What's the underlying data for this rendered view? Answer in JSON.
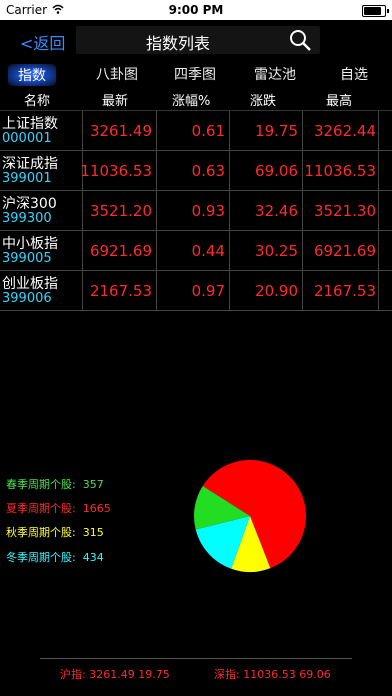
{
  "status": {
    "carrier": "Carrier",
    "time": "9:00 PM",
    "battery_level": 0.95
  },
  "nav": {
    "back_label": "<返回",
    "title": "指数列表"
  },
  "tabs": [
    "指数",
    "八卦图",
    "四季图",
    "雷达池",
    "自选"
  ],
  "columns": [
    "名称",
    "最新",
    "涨幅%",
    "涨跌",
    "最高"
  ],
  "rows": [
    {
      "name": "上证指数",
      "code": "000001",
      "latest": "3261.49",
      "pct": "0.61",
      "change": "19.75",
      "high": "3262.44"
    },
    {
      "name": "深证成指",
      "code": "399001",
      "latest": "11036.53",
      "pct": "0.63",
      "change": "69.06",
      "high": "11036.53"
    },
    {
      "name": "沪深300",
      "code": "399300",
      "latest": "3521.20",
      "pct": "0.93",
      "change": "32.46",
      "high": "3521.30"
    },
    {
      "name": "中小板指",
      "code": "399005",
      "latest": "6921.69",
      "pct": "0.44",
      "change": "30.25",
      "high": "6921.69"
    },
    {
      "name": "创业板指",
      "code": "399006",
      "latest": "2167.53",
      "pct": "0.97",
      "change": "20.90",
      "high": "2167.53"
    }
  ],
  "seasons": {
    "spring": {
      "label": "春季周期个股:",
      "count": "357"
    },
    "summer": {
      "label": "夏季周期个股:",
      "count": "1665"
    },
    "autumn": {
      "label": "秋季周期个股:",
      "count": "315"
    },
    "winter": {
      "label": "冬季周期个股:",
      "count": "434"
    }
  },
  "colors": {
    "spring": "#22dd22",
    "summer": "#ff0000",
    "autumn": "#ffff00",
    "winter": "#00ffff"
  },
  "footer": {
    "sh_label": "沪指:",
    "sh_value": "3261.49 19.75",
    "sz_label": "深指:",
    "sz_value": "11036.53 69.06"
  }
}
